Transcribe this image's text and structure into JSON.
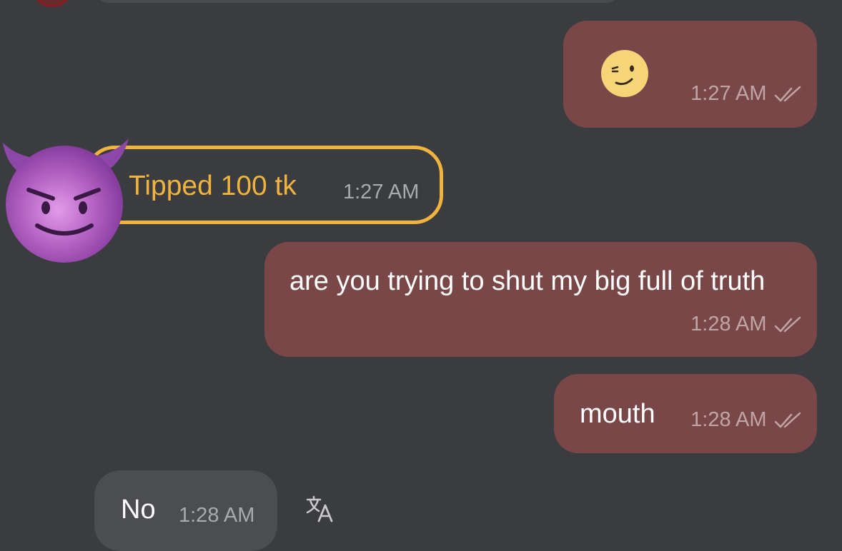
{
  "messages": [
    {
      "direction": "outgoing",
      "type": "emoji",
      "emoji_name": "winking-face-icon",
      "time": "1:27 AM",
      "status": "read"
    },
    {
      "direction": "incoming",
      "type": "tip",
      "text": "Tipped 100 tk",
      "time": "1:27 AM",
      "avatar": "smiling-devil-icon"
    },
    {
      "direction": "outgoing",
      "type": "text",
      "text": "are you trying to shut my big full of truth",
      "time": "1:28 AM",
      "status": "read"
    },
    {
      "direction": "outgoing",
      "type": "text",
      "text": "mouth",
      "time": "1:28 AM",
      "status": "read"
    },
    {
      "direction": "incoming",
      "type": "text",
      "text": "No",
      "time": "1:28 AM",
      "action_icon": "translate-icon"
    }
  ],
  "colors": {
    "background": "#3b3c3f",
    "outgoing_bubble": "#7a4749",
    "incoming_bubble": "#4c4d51",
    "tip_accent": "#f0b33e"
  }
}
